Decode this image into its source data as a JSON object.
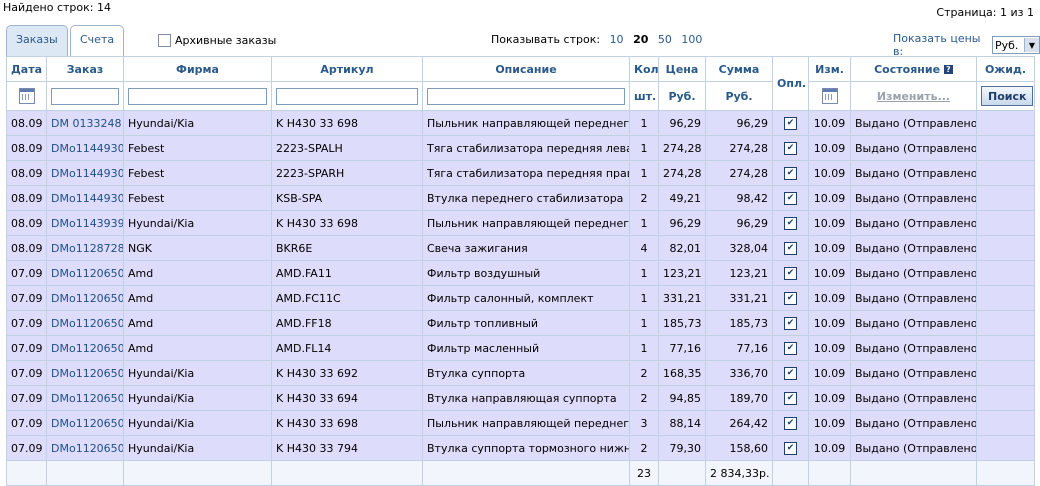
{
  "found_rows": "Найдено строк: 14",
  "page_info": "Страница: 1 из 1",
  "tabs": [
    {
      "label": "Заказы"
    },
    {
      "label": "Счета"
    }
  ],
  "archive_label": "Архивные заказы",
  "rows_per_page": {
    "label": "Показывать строк:",
    "options": [
      "10",
      "20",
      "50",
      "100"
    ],
    "selected": "20"
  },
  "prices_in": {
    "label": "Показать цены в:",
    "value": "Руб."
  },
  "columns": {
    "date": "Дата",
    "order": "Заказ",
    "firm": "Фирма",
    "article": "Артикул",
    "description": "Описание",
    "qty": "Кол",
    "qty_unit": "шт.",
    "price": "Цена",
    "price_unit": "Руб.",
    "sum": "Сумма",
    "sum_unit": "Руб.",
    "paid": "Опл.",
    "changed": "Изм.",
    "state": "Состояние",
    "state_change": "Изменить...",
    "wait": "Ожид.",
    "search_button": "Поиск"
  },
  "rows": [
    {
      "date": "08.09",
      "order": "DM 0133248",
      "firm": "Hyundai/Kia",
      "article": "K H430 33 698",
      "description": "Пыльник направляющей переднего",
      "qty": "1",
      "price": "96,29",
      "sum": "96,29",
      "changed": "10.09",
      "state": "Выдано (Отправлено)"
    },
    {
      "date": "08.09",
      "order": "DMo1144930",
      "firm": "Febest",
      "article": "2223-SPALH",
      "description": "Тяга стабилизатора передняя левая",
      "qty": "1",
      "price": "274,28",
      "sum": "274,28",
      "changed": "10.09",
      "state": "Выдано (Отправлено)"
    },
    {
      "date": "08.09",
      "order": "DMo1144930",
      "firm": "Febest",
      "article": "2223-SPARH",
      "description": "Тяга стабилизатора передняя правая",
      "qty": "1",
      "price": "274,28",
      "sum": "274,28",
      "changed": "10.09",
      "state": "Выдано (Отправлено)"
    },
    {
      "date": "08.09",
      "order": "DMo1144930",
      "firm": "Febest",
      "article": "KSB-SPA",
      "description": "Втулка переднего стабилизатора",
      "qty": "2",
      "price": "49,21",
      "sum": "98,42",
      "changed": "10.09",
      "state": "Выдано (Отправлено)"
    },
    {
      "date": "08.09",
      "order": "DMo1143939",
      "firm": "Hyundai/Kia",
      "article": "K H430 33 698",
      "description": "Пыльник направляющей переднего",
      "qty": "1",
      "price": "96,29",
      "sum": "96,29",
      "changed": "10.09",
      "state": "Выдано (Отправлено)"
    },
    {
      "date": "08.09",
      "order": "DMo1128728",
      "firm": "NGK",
      "article": "BKR6E",
      "description": "Свеча зажигания",
      "qty": "4",
      "price": "82,01",
      "sum": "328,04",
      "changed": "10.09",
      "state": "Выдано (Отправлено)"
    },
    {
      "date": "07.09",
      "order": "DMo1120650",
      "firm": "Amd",
      "article": "AMD.FA11",
      "description": "Фильтр воздушный",
      "qty": "1",
      "price": "123,21",
      "sum": "123,21",
      "changed": "10.09",
      "state": "Выдано (Отправлено)"
    },
    {
      "date": "07.09",
      "order": "DMo1120650",
      "firm": "Amd",
      "article": "AMD.FC11C",
      "description": "Фильтр салонный, комплект",
      "qty": "1",
      "price": "331,21",
      "sum": "331,21",
      "changed": "10.09",
      "state": "Выдано (Отправлено)"
    },
    {
      "date": "07.09",
      "order": "DMo1120650",
      "firm": "Amd",
      "article": "AMD.FF18",
      "description": "Фильтр топливный",
      "qty": "1",
      "price": "185,73",
      "sum": "185,73",
      "changed": "10.09",
      "state": "Выдано (Отправлено)"
    },
    {
      "date": "07.09",
      "order": "DMo1120650",
      "firm": "Amd",
      "article": "AMD.FL14",
      "description": "Фильтр масленный",
      "qty": "1",
      "price": "77,16",
      "sum": "77,16",
      "changed": "10.09",
      "state": "Выдано (Отправлено)"
    },
    {
      "date": "07.09",
      "order": "DMo1120650",
      "firm": "Hyundai/Kia",
      "article": "K H430 33 692",
      "description": "Втулка суппорта",
      "qty": "2",
      "price": "168,35",
      "sum": "336,70",
      "changed": "10.09",
      "state": "Выдано (Отправлено)"
    },
    {
      "date": "07.09",
      "order": "DMo1120650",
      "firm": "Hyundai/Kia",
      "article": "K H430 33 694",
      "description": "Втулка направляющая суппорта",
      "qty": "2",
      "price": "94,85",
      "sum": "189,70",
      "changed": "10.09",
      "state": "Выдано (Отправлено)"
    },
    {
      "date": "07.09",
      "order": "DMo1120650",
      "firm": "Hyundai/Kia",
      "article": "K H430 33 698",
      "description": "Пыльник направляющей переднего",
      "qty": "3",
      "price": "88,14",
      "sum": "264,42",
      "changed": "10.09",
      "state": "Выдано (Отправлено)"
    },
    {
      "date": "07.09",
      "order": "DMo1120650",
      "firm": "Hyundai/Kia",
      "article": "K H430 33 794",
      "description": "Втулка суппорта тормозного нижняя",
      "qty": "2",
      "price": "79,30",
      "sum": "158,60",
      "changed": "10.09",
      "state": "Выдано (Отправлено)"
    }
  ],
  "totals": {
    "qty": "23",
    "sum": "2 834,33р."
  },
  "colors": {
    "row_bg": "#dedcfb",
    "header_text": "#2a5a8a",
    "link": "#1f4f86"
  },
  "icons": {
    "calendar": "calendar-icon",
    "checkbox": "checkbox-checked-icon",
    "help": "help-icon",
    "dropdown": "chevron-down-icon"
  }
}
